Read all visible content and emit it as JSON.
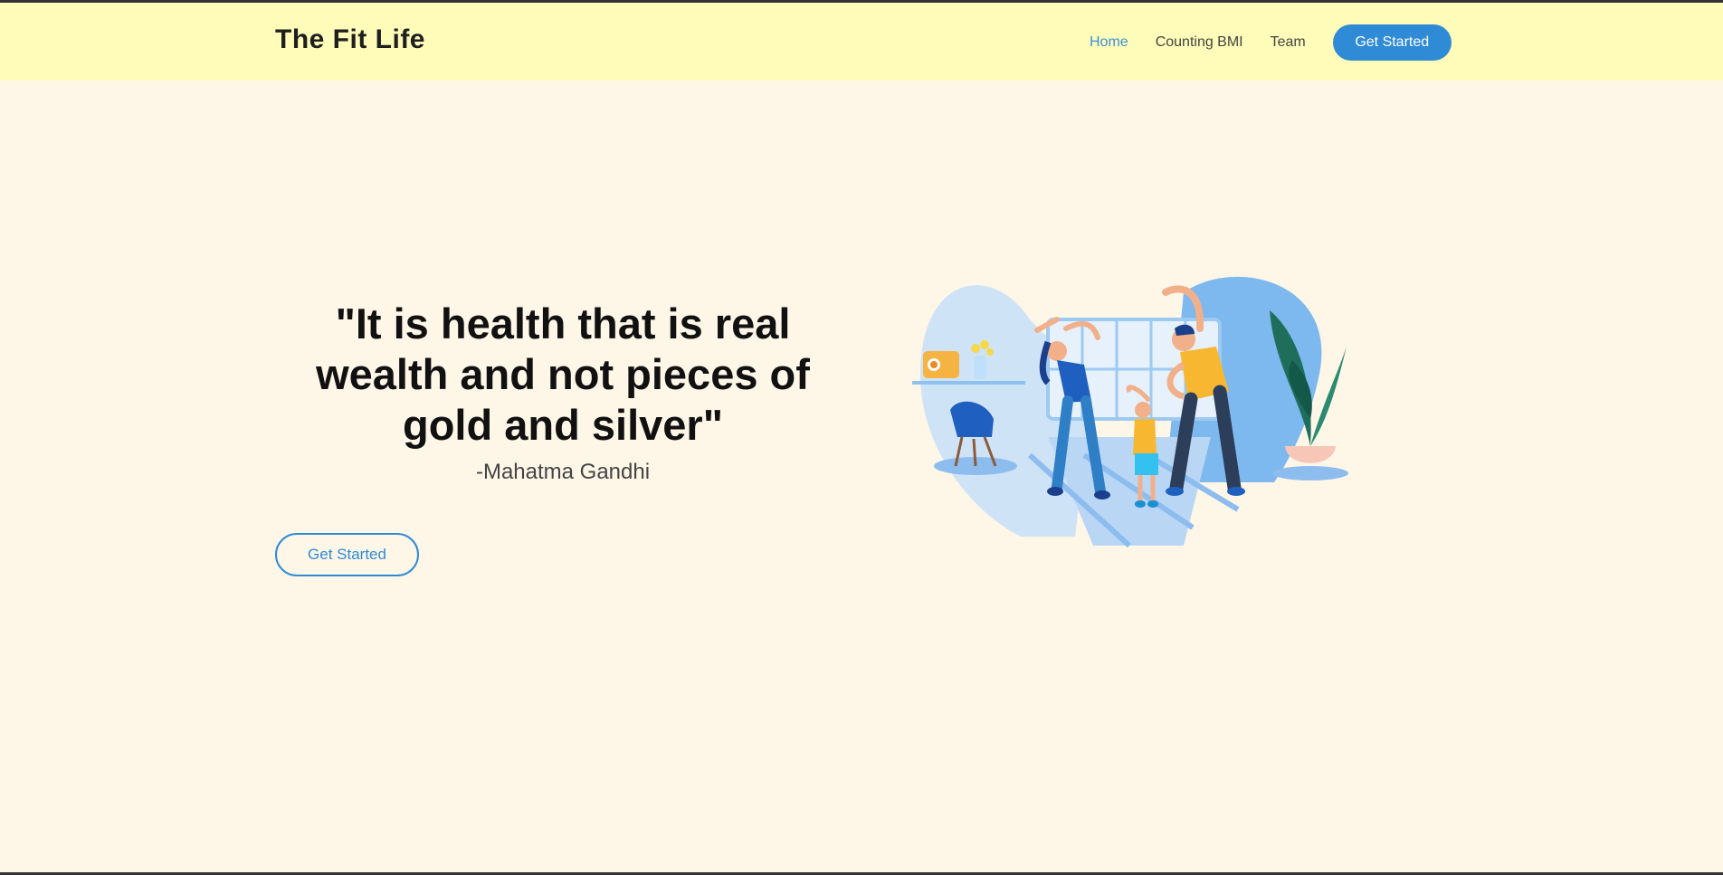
{
  "brand": "The Fit Life",
  "nav": {
    "items": [
      "Home",
      "Counting BMI",
      "Team"
    ],
    "cta": "Get Started"
  },
  "hero": {
    "quote": "\"It is health that is real wealth and not pieces of gold and silver\"",
    "author": "-Mahatma Gandhi",
    "cta": "Get Started"
  },
  "colors": {
    "navbar_bg": "#fefcb8",
    "page_bg": "#fef6e7",
    "accent": "#2f8bd6"
  }
}
